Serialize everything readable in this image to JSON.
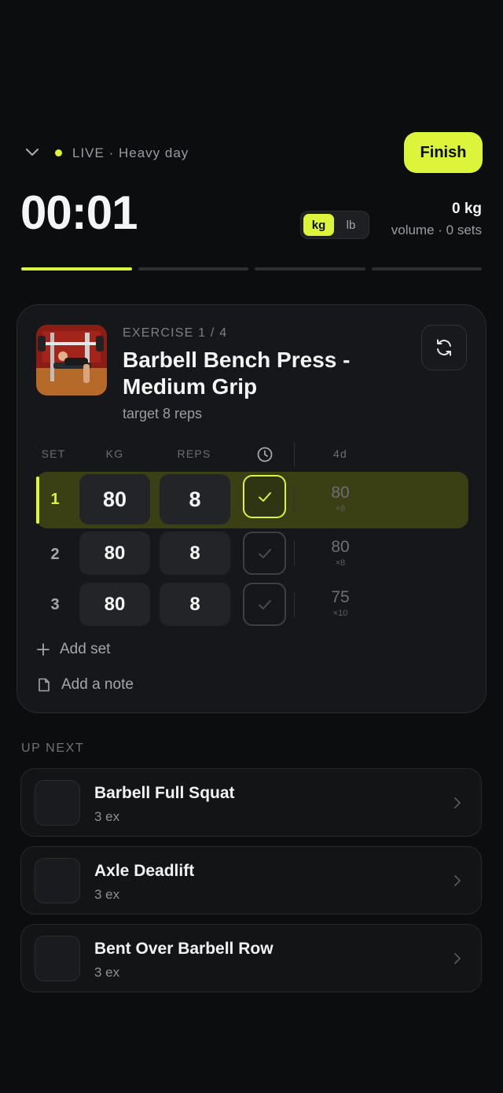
{
  "header": {
    "live_label": "LIVE · Heavy day",
    "finish_label": "Finish"
  },
  "timer": "00:01",
  "units": {
    "options": [
      "kg",
      "lb"
    ],
    "selected": "kg"
  },
  "volume": {
    "value": "0 kg",
    "subtitle": "volume · 0 sets"
  },
  "progress": {
    "total": 4,
    "completed": 1
  },
  "exercise": {
    "kicker": "EXERCISE 1 / 4",
    "name": "Barbell Bench Press - Medium Grip",
    "target": "target 8 reps",
    "columns": {
      "set": "SET",
      "kg": "KG",
      "reps": "REPS",
      "previous": "4d"
    },
    "sets": [
      {
        "num": "1",
        "kg": "80",
        "reps": "8",
        "done": true,
        "prev_kg": "80",
        "prev_reps": "×8"
      },
      {
        "num": "2",
        "kg": "80",
        "reps": "8",
        "done": false,
        "prev_kg": "80",
        "prev_reps": "×8"
      },
      {
        "num": "3",
        "kg": "80",
        "reps": "8",
        "done": false,
        "prev_kg": "75",
        "prev_reps": "×10"
      }
    ],
    "add_set_label": "Add set",
    "add_note_label": "Add a note"
  },
  "up_next": {
    "title": "UP NEXT",
    "items": [
      {
        "name": "Barbell Full Squat",
        "sub": "3 ex"
      },
      {
        "name": "Axle Deadlift",
        "sub": "3 ex"
      },
      {
        "name": "Bent Over Barbell Row",
        "sub": "3 ex"
      }
    ]
  },
  "colors": {
    "accent": "#dcf53a",
    "background": "#0c0d0f",
    "card": "#16171a"
  }
}
